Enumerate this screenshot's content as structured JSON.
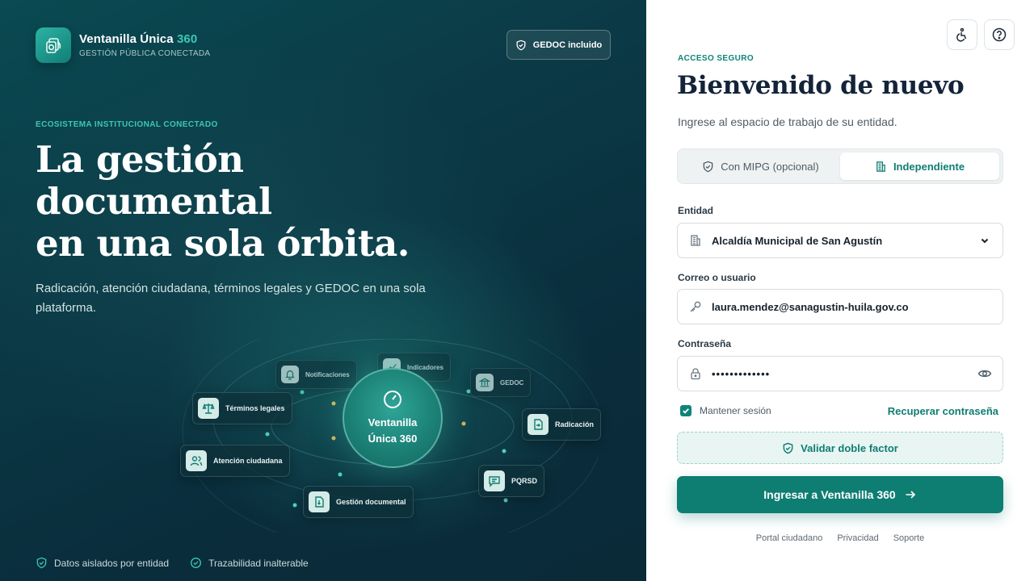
{
  "brand": {
    "name": "Ventanilla Única",
    "name_accent": "360",
    "tagline": "GESTIÓN PÚBLICA CONECTADA",
    "badge": "GEDOC incluido"
  },
  "hero": {
    "eyebrow": "ECOSISTEMA INSTITUCIONAL CONECTADO",
    "title_lines": [
      "La gestión",
      "documental",
      "en una sola órbita."
    ],
    "subtitle": "Radicación, atención ciudadana, términos legales y GEDOC en una sola plataforma."
  },
  "orbit": {
    "center_line1": "Ventanilla",
    "center_line2": "Única 360",
    "nodes": {
      "notificaciones": "Notificaciones",
      "indicadores": "Indicadores",
      "gedoc": "GEDOC",
      "terminos": "Términos legales",
      "radicacion": "Radicación",
      "atencion": "Atención ciudadana",
      "pqrsd": "PQRSD",
      "gestion": "Gestión documental"
    }
  },
  "footer_left": {
    "item1": "Datos aislados por entidad",
    "item2": "Trazabilidad inalterable"
  },
  "login": {
    "eyebrow": "ACCESO SEGURO",
    "title": "Bienvenido de nuevo",
    "subtitle": "Ingrese al espacio de trabajo de su entidad.",
    "toggle": {
      "option1": "Con MIPG (opcional)",
      "option2": "Independiente",
      "selected": "Independiente"
    },
    "entity_label": "Entidad",
    "entity_value": "Alcaldía Municipal de San Agustín",
    "user_label": "Correo o usuario",
    "user_value": "laura.mendez@sanagustin-huila.gov.co",
    "password_label": "Contraseña",
    "password_value": "•••••••••••••",
    "remember_label": "Mantener sesión",
    "remember_checked": true,
    "recover_link": "Recuperar contraseña",
    "mfa_button": "Validar doble factor",
    "submit_button": "Ingresar a Ventanilla 360"
  },
  "footer_links": [
    "Portal ciudadano",
    "Privacidad",
    "Soporte"
  ],
  "colors": {
    "accent": "#0e7d72",
    "accent_light": "#3cc7b2",
    "panel_dark": "#0a3a46",
    "heading": "#13233a"
  },
  "icons": [
    "accessibility-icon",
    "help-icon",
    "shield-icon",
    "building-icon",
    "key-icon",
    "lock-icon",
    "eye-icon",
    "arrow-right-icon",
    "check-circle-icon"
  ]
}
